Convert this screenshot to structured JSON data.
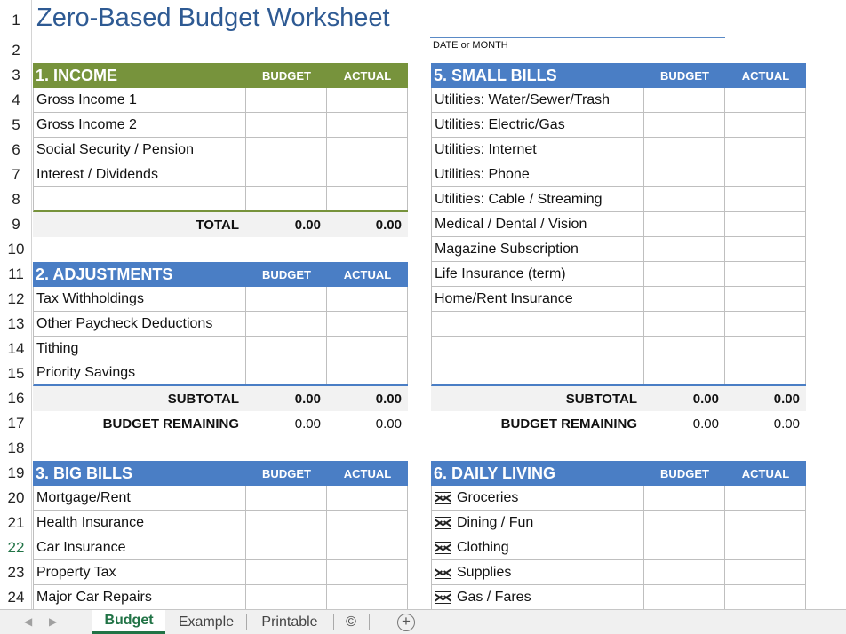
{
  "title": "Zero-Based Budget Worksheet",
  "date_label": "DATE  or MONTH",
  "row_numbers": [
    "1",
    "2",
    "3",
    "4",
    "5",
    "6",
    "7",
    "8",
    "9",
    "10",
    "11",
    "12",
    "13",
    "14",
    "15",
    "16",
    "17",
    "18",
    "19",
    "20",
    "21",
    "22",
    "23",
    "24"
  ],
  "selected_row": "22",
  "colors": {
    "green": "#77933c",
    "blue": "#4a7ec5",
    "title": "#2e5a93",
    "active_tab": "#217346"
  },
  "income": {
    "title": "1. INCOME",
    "budget": "BUDGET",
    "actual": "ACTUAL",
    "items": [
      "Gross Income 1",
      "Gross Income 2",
      "Social Security / Pension",
      "Interest / Dividends",
      ""
    ],
    "total": {
      "label": "TOTAL",
      "budget": "0.00",
      "actual": "0.00"
    }
  },
  "adjustments": {
    "title": "2. ADJUSTMENTS",
    "budget": "BUDGET",
    "actual": "ACTUAL",
    "items": [
      "Tax Withholdings",
      "Other Paycheck Deductions",
      "Tithing",
      "Priority Savings"
    ],
    "subtotal": {
      "label": "SUBTOTAL",
      "budget": "0.00",
      "actual": "0.00"
    },
    "remaining": {
      "label": "BUDGET REMAINING",
      "budget": "0.00",
      "actual": "0.00"
    }
  },
  "big_bills": {
    "title": "3. BIG BILLS",
    "budget": "BUDGET",
    "actual": "ACTUAL",
    "items": [
      "Mortgage/Rent",
      "Health Insurance",
      "Car Insurance",
      "Property Tax",
      "Major Car Repairs"
    ]
  },
  "small_bills": {
    "title": "5. SMALL BILLS",
    "budget": "BUDGET",
    "actual": "ACTUAL",
    "items": [
      "Utilities: Water/Sewer/Trash",
      "Utilities: Electric/Gas",
      "Utilities: Internet",
      "Utilities: Phone",
      "Utilities: Cable / Streaming",
      "Medical / Dental / Vision",
      "Magazine Subscription",
      "Life Insurance (term)",
      "Home/Rent Insurance",
      "",
      "",
      ""
    ],
    "subtotal": {
      "label": "SUBTOTAL",
      "budget": "0.00",
      "actual": "0.00"
    },
    "remaining": {
      "label": "BUDGET REMAINING",
      "budget": "0.00",
      "actual": "0.00"
    }
  },
  "daily_living": {
    "title": "6. DAILY LIVING",
    "budget": "BUDGET",
    "actual": "ACTUAL",
    "items": [
      "Groceries",
      "Dining / Fun",
      "Clothing",
      "Supplies",
      "Gas / Fares"
    ],
    "item_icon": "envelope-icon"
  },
  "tabs": [
    {
      "label": "Budget",
      "active": true
    },
    {
      "label": "Example",
      "active": false
    },
    {
      "label": "Printable",
      "active": false
    },
    {
      "label": "©",
      "active": false
    }
  ],
  "nav": {
    "prev": "◀",
    "next": "▶",
    "add": "+"
  }
}
